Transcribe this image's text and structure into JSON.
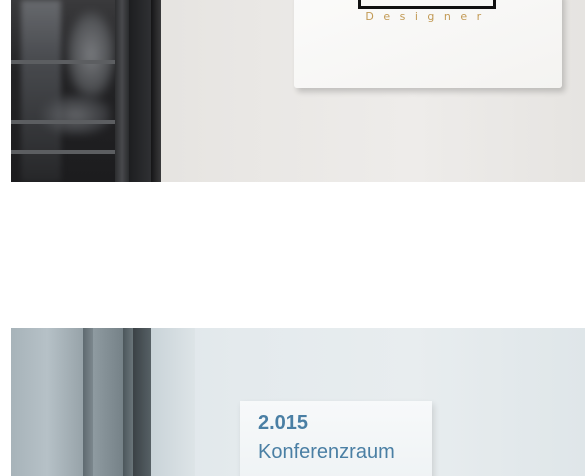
{
  "photo_top": {
    "sign_logo_text": "Designer",
    "sign_text_color": "#c29a55"
  },
  "photo_bottom": {
    "room_number": "2.015",
    "room_name": "Konferenzraum",
    "sign_text_color": "#4a7fa4"
  }
}
